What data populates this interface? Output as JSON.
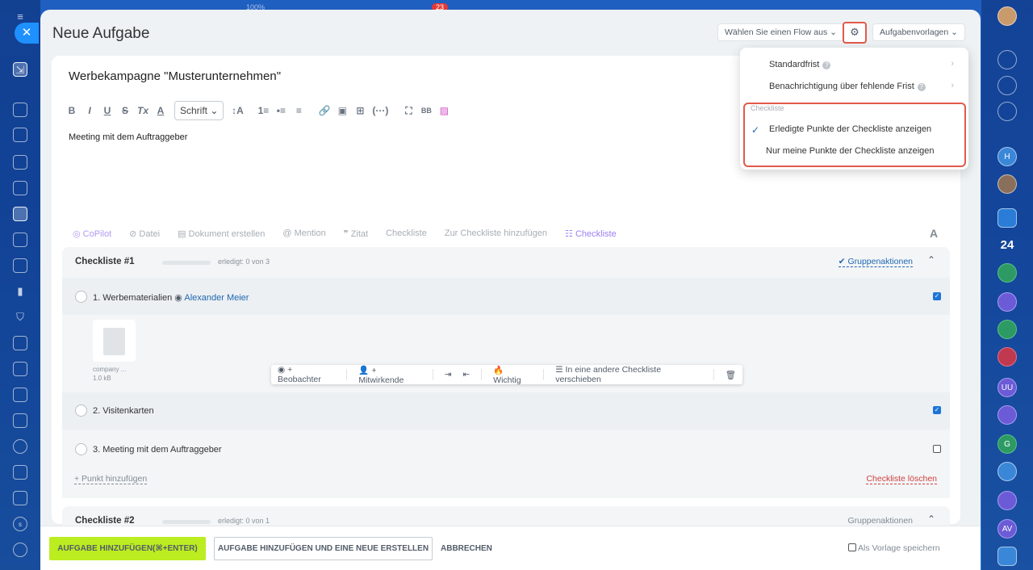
{
  "topbar": {
    "percent": "100%",
    "badge": "23"
  },
  "left_nav": {
    "close_icon": "✕"
  },
  "header": {
    "title": "Neue Aufgabe",
    "flow_select": "Wählen Sie einen Flow aus",
    "templates_select": "Aufgabenvorlagen"
  },
  "task": {
    "title": "Werbekampagne \"Musterunternehmen\"",
    "description": "Meeting mit dem Auftraggeber",
    "font_select": "Schrift"
  },
  "toolbar": {
    "bold": "B",
    "italic": "I",
    "underline": "U",
    "strike": "S",
    "clear_format": "Tx",
    "font_color": "A",
    "font_size": "↕A",
    "ol": "1≡",
    "ul": "•≡",
    "align": "≡",
    "link": "🔗",
    "image": "▣",
    "table": "⊞",
    "code": "(···)",
    "expand": "⛶",
    "bbcode": "BB",
    "media": "▨"
  },
  "actions": {
    "copilot": "CoPilot",
    "file": "Datei",
    "document": "Dokument erstellen",
    "mention": "Mention",
    "quote": "Zitat",
    "checklist": "Checkliste",
    "add_to_checklist": "Zur Checkliste hinzufügen",
    "checklist2": "Checkliste",
    "font": "A"
  },
  "checklist1": {
    "title": "Checkliste #1",
    "done": "erledigt: 0 von 3",
    "group_actions": "Gruppenaktionen",
    "items": [
      {
        "label": "1. Werbematerialien",
        "user": "Alexander Meier",
        "checked": true
      },
      {
        "label": "2. Visitenkarten",
        "checked": true
      },
      {
        "label": "3. Meeting mit dem Auftraggeber",
        "checked": false
      }
    ],
    "file": {
      "name": "company ...",
      "size": "1.0 kB"
    },
    "add_point": "+ Punkt hinzufügen",
    "delete": "Checkliste löschen"
  },
  "item_toolbar": {
    "observer": "+ Beobachter",
    "participant": "+ Mitwirkende",
    "important": "Wichtig",
    "move": "In eine andere Checkliste verschieben"
  },
  "checklist2": {
    "title": "Checkliste #2",
    "done": "erledigt: 0 von 1",
    "group_actions": "Gruppenaktionen"
  },
  "footer": {
    "add_task": "AUFGABE HINZUFÜGEN(⌘+ENTER)",
    "add_and_new": "AUFGABE HINZUFÜGEN UND EINE NEUE ERSTELLEN",
    "cancel": "ABBRECHEN",
    "save_template": "Als Vorlage speichern"
  },
  "dropdown": {
    "standard_deadline": "Standardfrist",
    "missing_deadline": "Benachrichtigung über fehlende Frist",
    "section": "Checkliste",
    "show_done": "Erledigte Punkte der Checkliste anzeigen",
    "only_mine": "Nur meine Punkte der Checkliste anzeigen"
  },
  "right_nav": {
    "counter": "24",
    "avatars": [
      "H",
      "UU",
      "G",
      "AV"
    ]
  },
  "colors": {
    "accent": "#2067b0",
    "primary_button": "#bbed21",
    "highlight": "#e15a4a"
  }
}
